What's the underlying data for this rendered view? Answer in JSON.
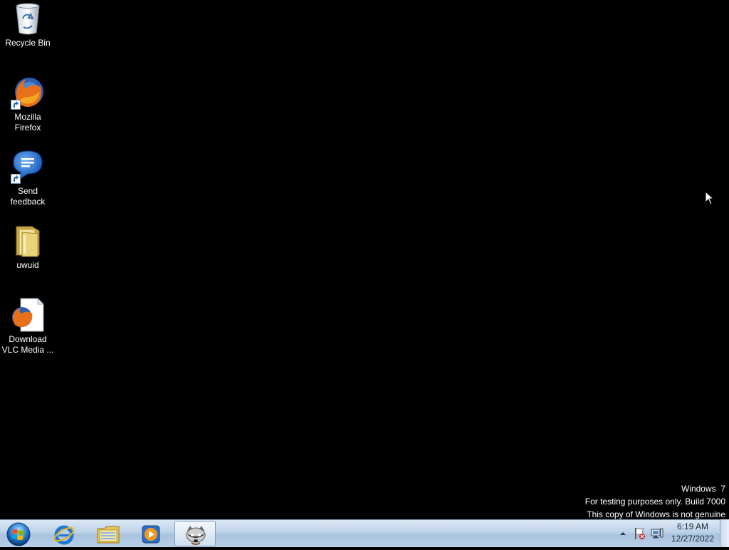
{
  "desktop": {
    "icons": [
      {
        "label": "Recycle Bin",
        "icon": "recycle-bin-icon"
      },
      {
        "label": "Mozilla\nFirefox",
        "icon": "firefox-icon"
      },
      {
        "label": "Send\nfeedback",
        "icon": "feedback-icon"
      },
      {
        "label": "uwuid",
        "icon": "folder-icon"
      },
      {
        "label": "Download\nVLC Media ...",
        "icon": "firefox-document-icon"
      }
    ]
  },
  "watermark": {
    "line1": "Windows  7",
    "line2": "For testing purposes only. Build 7000",
    "line3": "This copy of Windows is not genuine"
  },
  "taskbar": {
    "start_icon": "windows-logo-icon",
    "pinned": [
      {
        "name": "Internet Explorer",
        "icon": "internet-explorer-icon",
        "active": false
      },
      {
        "name": "Windows Explorer",
        "icon": "file-explorer-icon",
        "active": false
      },
      {
        "name": "Windows Media Player",
        "icon": "media-player-icon",
        "active": false
      },
      {
        "name": "Raccoon app",
        "icon": "raccoon-icon",
        "active": true
      }
    ],
    "tray": {
      "icons": [
        "show-hidden-icons-arrow",
        "action-center-flag-icon",
        "network-icon"
      ],
      "time": "6:19 AM",
      "date": "12/27/2022"
    },
    "colors": {
      "bar_top": "#dce8f4",
      "bar_bottom": "#a9c2de",
      "desktop_bg": "#000000"
    }
  }
}
